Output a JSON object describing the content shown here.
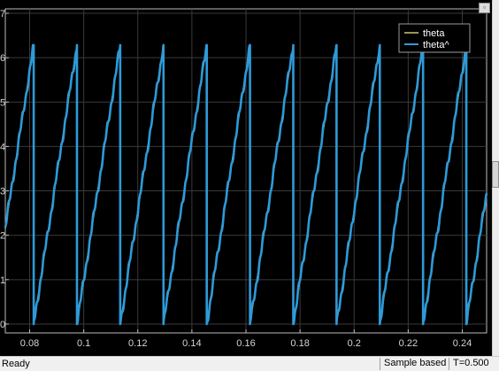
{
  "window": {
    "restore_icon": "window-restore-icon",
    "restore_glyph": "▫"
  },
  "colors": {
    "plot_background": "#000000",
    "grid": "#3a3a3a",
    "axis": "#bdbdbd",
    "theta_line": "#e6e68a",
    "theta_hat_line": "#2e9ad8"
  },
  "chart_data": {
    "type": "line",
    "title": "",
    "xlabel": "",
    "ylabel": "",
    "xlim": [
      0.071,
      0.249
    ],
    "ylim": [
      -0.2,
      7.1
    ],
    "x_ticks": [
      0.08,
      0.1,
      0.12,
      0.14,
      0.16,
      0.18,
      0.2,
      0.22,
      0.24
    ],
    "x_tick_labels": [
      "0.08",
      "0.1",
      "0.12",
      "0.14",
      "0.16",
      "0.18",
      "0.2",
      "0.22",
      "0.24"
    ],
    "y_ticks": [
      0,
      1,
      2,
      3,
      4,
      5,
      6,
      7
    ],
    "y_tick_labels": [
      "0",
      "1",
      "2",
      "3",
      "4",
      "5",
      "6",
      "7"
    ],
    "grid": true,
    "legend_placement": "top-right",
    "waveform": "sawtooth",
    "wrap_period": 0.016,
    "wrap_x": [
      0.0815,
      0.0975,
      0.1135,
      0.1295,
      0.1455,
      0.1615,
      0.1775,
      0.1935,
      0.2095,
      0.2255,
      0.2415
    ],
    "y_min": 0,
    "y_max": 6.283,
    "series": [
      {
        "name": "theta",
        "color": "#e6e68a",
        "width": 1.3,
        "noise": 0.0
      },
      {
        "name": "theta^",
        "color": "#2e9ad8",
        "width": 2.6,
        "noise": 0.12
      }
    ]
  },
  "status": {
    "text": "Ready",
    "mode": "Sample based",
    "time": "T=0.500"
  }
}
